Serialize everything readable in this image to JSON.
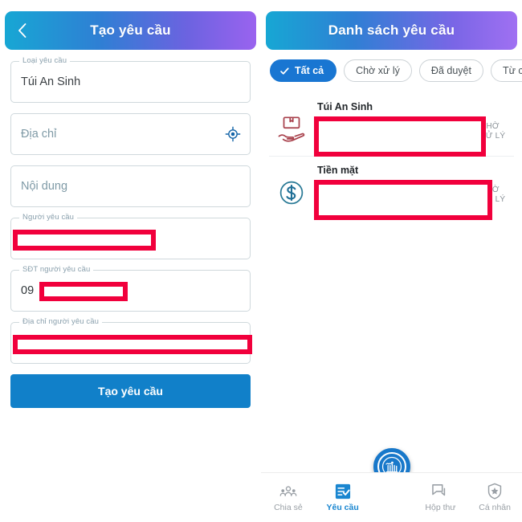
{
  "left_screen": {
    "header": {
      "title": "Tạo yêu cầu",
      "back_icon": "chevron-left-icon",
      "gradient_from": "#17a7d4",
      "gradient_to": "#9a63ef"
    },
    "fields": [
      {
        "label": "Loại yêu cầu",
        "value": "Túi An Sinh",
        "placeholder": "",
        "redacted": false
      },
      {
        "label": "",
        "value": "",
        "placeholder": "Địa chỉ",
        "icon": "gps-location-icon",
        "redacted": false
      },
      {
        "label": "",
        "value": "",
        "placeholder": "Nội dung",
        "redacted": false
      },
      {
        "label": "Người yêu cầu",
        "value": "",
        "placeholder": "",
        "redacted": true
      },
      {
        "label": "SĐT người yêu cầu",
        "value": "09",
        "placeholder": "",
        "redacted": true
      },
      {
        "label": "Địa chỉ người yêu cầu",
        "value": "",
        "placeholder": "",
        "redacted": true
      }
    ],
    "submit": {
      "label": "Tạo yêu cầu",
      "color": "#1180c9"
    }
  },
  "right_screen": {
    "header": {
      "title": "Danh sách yêu cầu",
      "gradient_from": "#17a7d4",
      "gradient_to": "#a070f2"
    },
    "filters": [
      {
        "label": "Tất cả",
        "selected": true,
        "icon": "check-icon"
      },
      {
        "label": "Chờ xử lý",
        "selected": false
      },
      {
        "label": "Đã duyệt",
        "selected": false
      },
      {
        "label": "Từ ch",
        "selected": false
      }
    ],
    "requests": [
      {
        "title": "Túi An Sinh",
        "icon": "package-in-hand-icon",
        "icon_color": "#a8414c",
        "status_line1": "CHỜ",
        "status_line2": "XỬ LÝ",
        "redacted": true
      },
      {
        "title": "Tiền mặt",
        "icon": "dollar-circle-icon",
        "icon_color": "#2a7a96",
        "status_line1": "CHỜ",
        "status_line2": "XỬ LÝ",
        "redacted": true
      }
    ],
    "fab": {
      "icon": "app-logo-icon",
      "color": "#1878ca"
    },
    "bottom_nav": [
      {
        "label": "Chia sẻ",
        "icon": "people-group-icon",
        "active": false
      },
      {
        "label": "Yêu cầu",
        "icon": "checklist-icon",
        "active": true
      },
      {
        "label": "Hộp thư",
        "icon": "chat-bubbles-icon",
        "active": false
      },
      {
        "label": "Cá nhân",
        "icon": "shield-star-icon",
        "active": false
      }
    ],
    "accent_color": "#1a86d0",
    "redaction_color": "#f1003c"
  }
}
